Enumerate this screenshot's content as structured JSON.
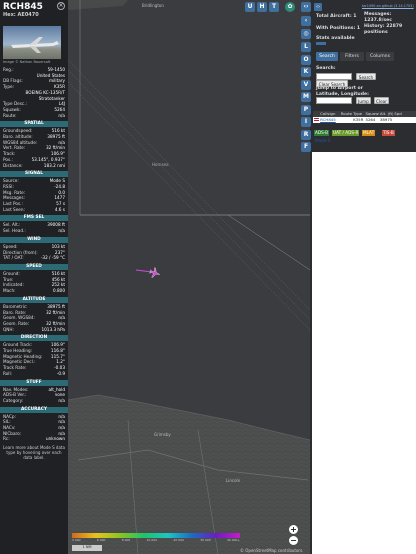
{
  "aircraft": {
    "callsign": "RCH845",
    "hex": "Hex: AE0470",
    "photo_credit": "Image © Nathan Bauersoft"
  },
  "info_rows": [
    {
      "k": "Reg.:",
      "v": "59-1450"
    },
    {
      "k": "",
      "v": "United States"
    },
    {
      "k": "DB Flags:",
      "v": "military"
    },
    {
      "k": "Type:",
      "v": "K35R"
    },
    {
      "k": "",
      "v": "BOEING KC-135R/T"
    },
    {
      "k": "",
      "v": "Stratotanker"
    },
    {
      "k": "Type Desc.:",
      "v": "L4J"
    },
    {
      "k": "Squawk:",
      "v": "5264"
    },
    {
      "k": "Route:",
      "v": "n/a"
    }
  ],
  "sections": [
    {
      "title": "SPATIAL",
      "rows": [
        {
          "k": "Groundspeed:",
          "v": "516 kt"
        },
        {
          "k": "Baro. altitude:",
          "v": "38975 ft"
        },
        {
          "k": "WGS84 altitude:",
          "v": "n/a"
        },
        {
          "k": "Vert. Rate:",
          "v": "32 ft/min"
        },
        {
          "k": "Track:",
          "v": "106.9°"
        },
        {
          "k": "Pos.:",
          "v": "53.145°, 0.937°"
        },
        {
          "k": "Distance:",
          "v": "183.2 nmi"
        }
      ]
    },
    {
      "title": "SIGNAL",
      "rows": [
        {
          "k": "Source:",
          "v": "Mode S"
        },
        {
          "k": "RSSI:",
          "v": "-24.8"
        },
        {
          "k": "Msg. Rate:",
          "v": "0.0"
        },
        {
          "k": "Messages:",
          "v": "1477"
        },
        {
          "k": "Last Pos.:",
          "v": "57 s"
        },
        {
          "k": "Last Seen:",
          "v": "4.6 s"
        }
      ]
    },
    {
      "title": "FMS SEL",
      "rows": [
        {
          "k": "Sel. Alt.:",
          "v": "39008 ft"
        },
        {
          "k": "Sel. Head.:",
          "v": "n/a"
        }
      ]
    },
    {
      "title": "WIND",
      "rows": [
        {
          "k": "Speed:",
          "v": "103 kt"
        },
        {
          "k": "Direction (from):",
          "v": "237°"
        },
        {
          "k": "TAT / OAT:",
          "v": "-32 / -59 °C"
        }
      ]
    },
    {
      "title": "SPEED",
      "rows": [
        {
          "k": "Ground:",
          "v": "516 kt"
        },
        {
          "k": "True:",
          "v": "456 kt"
        },
        {
          "k": "Indicated:",
          "v": "252 kt"
        },
        {
          "k": "Mach:",
          "v": "0.800"
        }
      ]
    },
    {
      "title": "ALTITUDE",
      "rows": [
        {
          "k": "Barometric:",
          "v": "38975 ft"
        },
        {
          "k": "Baro. Rate:",
          "v": "32 ft/min"
        },
        {
          "k": "Geom. WGS84:",
          "v": "n/a"
        },
        {
          "k": "Geom. Rate:",
          "v": "32 ft/min"
        },
        {
          "k": "QNH:",
          "v": "1013.3 hPa"
        }
      ]
    },
    {
      "title": "DIRECTION",
      "rows": [
        {
          "k": "Ground Track:",
          "v": "106.9°"
        },
        {
          "k": "True Heading:",
          "v": "116.8°"
        },
        {
          "k": "Magnetic Heading:",
          "v": "115.7°"
        },
        {
          "k": "Magnetic Decl.:",
          "v": "1.2°"
        },
        {
          "k": "Track Rate:",
          "v": "-0.03"
        },
        {
          "k": "Roll:",
          "v": "-0.9"
        }
      ]
    },
    {
      "title": "STUFF",
      "rows": [
        {
          "k": "Nav. Modes:",
          "v": "alt_hold"
        },
        {
          "k": "ADS-B Ver.:",
          "v": "none"
        },
        {
          "k": "Category:",
          "v": "n/a"
        }
      ]
    },
    {
      "title": "ACCURACY",
      "rows": [
        {
          "k": "NACp:",
          "v": "n/a"
        },
        {
          "k": "SIL:",
          "v": "n/a"
        },
        {
          "k": "NACv:",
          "v": "n/a"
        },
        {
          "k": "NICbaro:",
          "v": "n/a"
        },
        {
          "k": "Rc:",
          "v": "unknown"
        }
      ]
    }
  ],
  "footer_text": "Learn more about Mode S data type by hovering over each data label.",
  "map": {
    "top_buttons": [
      "U",
      "H",
      "T"
    ],
    "side_buttons": [
      "L",
      "O",
      "K",
      "V",
      "M",
      "P",
      "I",
      "R",
      "F"
    ],
    "scale_label": "1 NM",
    "attribution": "© OpenStreetMap contributors.",
    "altitude_scale": [
      "4 000",
      "6 000",
      "8 000",
      "10 000",
      "20 000",
      "30 000",
      "40 000+"
    ],
    "zoom_in": "+",
    "zoom_out": "−",
    "places": [
      "Bridlington",
      "Hornsea",
      "Grimsby",
      "Lincoln"
    ]
  },
  "sidebar": {
    "version": "tar1090 on github (3.14.1703)",
    "total_aircraft": "Total Aircraft: 1",
    "with_positions": "With Positions: 1",
    "messages": "Messages: 1237.8/sec",
    "history": "History: 22879 positions",
    "stats_label": "Stats available",
    "tabs": [
      "Search",
      "Filters",
      "Columns"
    ],
    "search_label": "Search:",
    "search_button": "Search",
    "clear_search": "Clear Search",
    "jump_label": "Jump to Airport or Latitude, Longitude:",
    "jump_button": "Jump",
    "clear_button": "Clear"
  },
  "table": {
    "headers": [
      "",
      "Callsign",
      "Route",
      "Type",
      "Squawk",
      "Alt. (ft)",
      "Spd"
    ],
    "rows": [
      [
        "",
        "RCH845",
        "",
        "K35R",
        "5264",
        "38975",
        ""
      ]
    ]
  },
  "badges": [
    {
      "label": "ADS-B",
      "color": "#2e7d32"
    },
    {
      "label": "UAT / ADS-R",
      "color": "#6a9a2a"
    },
    {
      "label": "MLAT",
      "color": "#d68a12"
    },
    {
      "label": "TIS-B",
      "color": "#c94a3a"
    },
    {
      "label": "Mode-S",
      "color": "#1f56a3"
    }
  ],
  "colors": {
    "accent": "#3f6f9e",
    "section": "#2c6a76",
    "aircraft": "#d04bd6"
  }
}
